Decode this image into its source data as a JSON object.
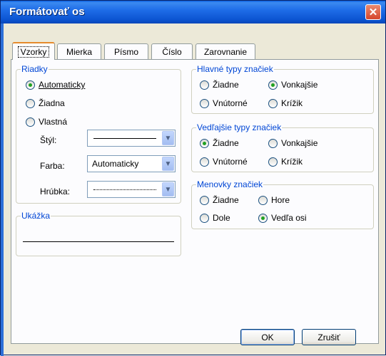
{
  "window": {
    "title": "Formátovať os",
    "close_glyph": "✕"
  },
  "tabs": [
    {
      "label": "Vzorky",
      "active": true
    },
    {
      "label": "Mierka"
    },
    {
      "label": "Písmo"
    },
    {
      "label": "Číslo"
    },
    {
      "label": "Zarovnanie"
    }
  ],
  "riadky": {
    "legend": "Riadky",
    "options": [
      {
        "label": "Automaticky",
        "selected": true
      },
      {
        "label": "Žiadna",
        "selected": false
      },
      {
        "label": "Vlastná",
        "selected": false
      }
    ],
    "styl_label": "Štýl:",
    "farba_label": "Farba:",
    "farba_value": "Automaticky",
    "hrubka_label": "Hrúbka:"
  },
  "ukazka": {
    "legend": "Ukážka"
  },
  "hlavne": {
    "legend": "Hlavné typy značiek",
    "options": [
      {
        "label": "Žiadne",
        "selected": false
      },
      {
        "label": "Vonkajšie",
        "selected": true
      },
      {
        "label": "Vnútorné",
        "selected": false
      },
      {
        "label": "Krížik",
        "selected": false
      }
    ]
  },
  "vedlajsie": {
    "legend": "Vedľajšie typy značiek",
    "options": [
      {
        "label": "Žiadne",
        "selected": true
      },
      {
        "label": "Vonkajšie",
        "selected": false
      },
      {
        "label": "Vnútorné",
        "selected": false
      },
      {
        "label": "Krížik",
        "selected": false
      }
    ]
  },
  "menovky": {
    "legend": "Menovky značiek",
    "options": [
      {
        "label": "Žiadne",
        "selected": false
      },
      {
        "label": "Hore",
        "selected": false
      },
      {
        "label": "Dole",
        "selected": false
      },
      {
        "label": "Vedľa osi",
        "selected": true
      }
    ]
  },
  "buttons": {
    "ok": "OK",
    "cancel": "Zrušiť"
  },
  "icons": {
    "dropdown": "chevron-down-icon",
    "close": "close-icon"
  },
  "colors": {
    "title_bar": "#0a5fe0",
    "legend_text": "#0046d5",
    "radio_dot": "#21a121",
    "tab_highlight": "#e68b2c"
  }
}
